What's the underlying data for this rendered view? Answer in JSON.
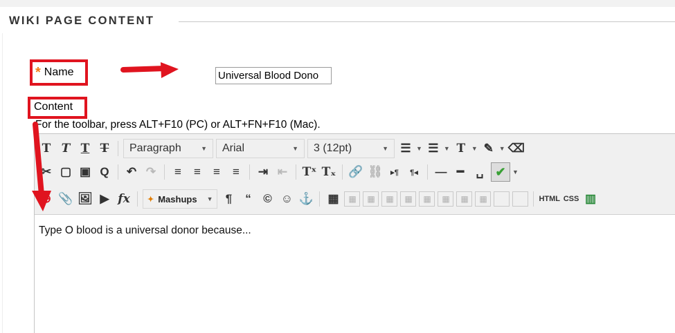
{
  "section": {
    "title": "WIKI PAGE CONTENT"
  },
  "name_field": {
    "label": "Name",
    "required_mark": "*",
    "value": "Universal Blood Dono"
  },
  "content_field": {
    "label": "Content",
    "toolbar_hint": "For the toolbar, press ALT+F10 (PC) or ALT+FN+F10 (Mac)."
  },
  "toolbar": {
    "paragraph_label": "Paragraph",
    "font_label": "Arial",
    "size_label": "3 (12pt)",
    "mashups_label": "Mashups",
    "html_label": "HTML",
    "css_label": "CSS",
    "glyphs": {
      "bold": "T",
      "italic": "T",
      "underline": "T",
      "strike": "T",
      "cut": "✂",
      "copy": "▢",
      "paste": "▣",
      "find": "Q",
      "undo": "↶",
      "redo": "↷",
      "align_left": "≡",
      "align_center": "≡",
      "align_right": "≡",
      "justify": "≡",
      "indent": "⇥",
      "outdent": "⇤",
      "superscript": "Tˣ",
      "subscript": "Tₓ",
      "link": "🔗",
      "unlink": "⛓",
      "ltr": "▸¶",
      "rtl": "¶◂",
      "hr": "—",
      "hr_thick": "━",
      "nbsp": "␣",
      "attach": "📎",
      "image": "🖼",
      "media": "▶",
      "formula": "fx",
      "pilcrow": "¶",
      "quote": "“",
      "copyright": "©",
      "emoji": "☺",
      "anchor": "⚓",
      "table": "▦",
      "text_color": "T",
      "highlight": "✎",
      "eraser": "⌫",
      "spellcheck": "✔",
      "bullets": "☰",
      "numbers": "☰",
      "insert": "⊕"
    }
  },
  "editor": {
    "body_text": "Type O blood is a universal donor because..."
  },
  "colors": {
    "annotation_red": "#e0141f",
    "required_orange": "#f27b16"
  }
}
